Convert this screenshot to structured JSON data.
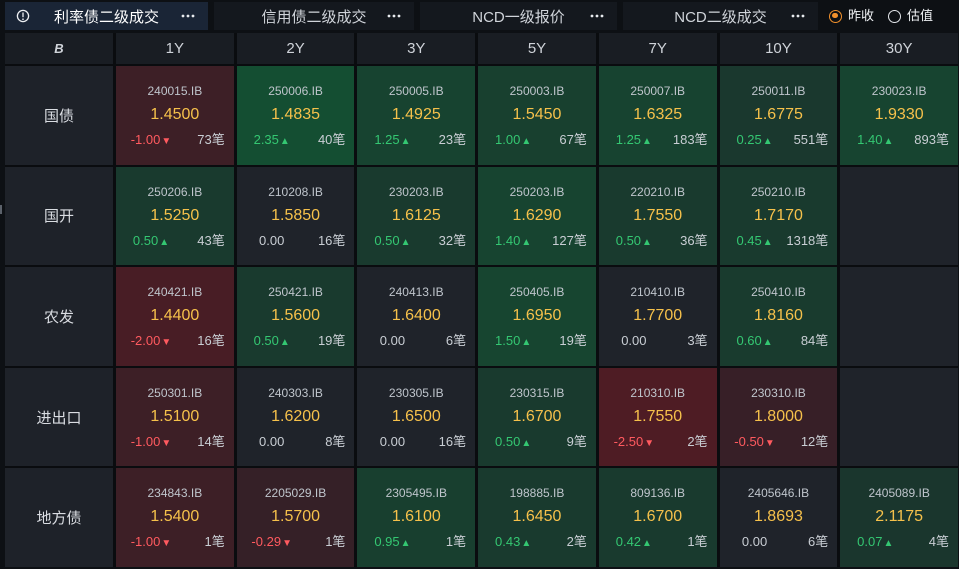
{
  "tabs": [
    {
      "label": "利率债二级成交",
      "active": true
    },
    {
      "label": "信用债二级成交",
      "active": false
    },
    {
      "label": "NCD一级报价",
      "active": false
    },
    {
      "label": "NCD二级成交",
      "active": false
    }
  ],
  "price_basis": {
    "options": [
      {
        "label": "昨收",
        "selected": true
      },
      {
        "label": "估值",
        "selected": false
      }
    ]
  },
  "icons": {
    "tab_info": "info-icon",
    "tab_menu": "more-horizontal-icon",
    "arrow_up": "▲",
    "arrow_down": "▼"
  },
  "colors": {
    "page_bg": "#0d1014",
    "tab_bg": "#14181e",
    "tab_active_bg": "#1a2536",
    "grid_gap": "#0a0c0f",
    "header_bg": "#191d23",
    "row_head_bg": "#1e2229",
    "cell_neutral": "#1f232a",
    "cell_up": "#145032",
    "cell_down": "#4e1c24",
    "price": "#f6c14b",
    "up": "#34c772",
    "down": "#ff5a5f",
    "radio_selected": "#f2912c"
  },
  "grid": {
    "corner_logo": "B",
    "tenors": [
      "1Y",
      "2Y",
      "3Y",
      "5Y",
      "7Y",
      "10Y",
      "30Y"
    ],
    "rows": [
      {
        "name": "国债",
        "cells": [
          {
            "code": "240015.IB",
            "price": "1.4500",
            "change": "-1.00",
            "direction": "down",
            "count": "73笔"
          },
          {
            "code": "250006.IB",
            "price": "1.4835",
            "change": "2.35",
            "direction": "up",
            "count": "40笔"
          },
          {
            "code": "250005.IB",
            "price": "1.4925",
            "change": "1.25",
            "direction": "up",
            "count": "23笔"
          },
          {
            "code": "250003.IB",
            "price": "1.5450",
            "change": "1.00",
            "direction": "up",
            "count": "67笔"
          },
          {
            "code": "250007.IB",
            "price": "1.6325",
            "change": "1.25",
            "direction": "up",
            "count": "183笔"
          },
          {
            "code": "250011.IB",
            "price": "1.6775",
            "change": "0.25",
            "direction": "up",
            "count": "551笔"
          },
          {
            "code": "230023.IB",
            "price": "1.9330",
            "change": "1.40",
            "direction": "up",
            "count": "893笔"
          }
        ]
      },
      {
        "name": "国开",
        "cells": [
          {
            "code": "250206.IB",
            "price": "1.5250",
            "change": "0.50",
            "direction": "up",
            "count": "43笔"
          },
          {
            "code": "210208.IB",
            "price": "1.5850",
            "change": "0.00",
            "direction": "flat",
            "count": "16笔"
          },
          {
            "code": "230203.IB",
            "price": "1.6125",
            "change": "0.50",
            "direction": "up",
            "count": "32笔"
          },
          {
            "code": "250203.IB",
            "price": "1.6290",
            "change": "1.40",
            "direction": "up",
            "count": "127笔"
          },
          {
            "code": "220210.IB",
            "price": "1.7550",
            "change": "0.50",
            "direction": "up",
            "count": "36笔"
          },
          {
            "code": "250210.IB",
            "price": "1.7170",
            "change": "0.45",
            "direction": "up",
            "count": "1318笔"
          },
          null
        ]
      },
      {
        "name": "农发",
        "cells": [
          {
            "code": "240421.IB",
            "price": "1.4400",
            "change": "-2.00",
            "direction": "down",
            "count": "16笔"
          },
          {
            "code": "250421.IB",
            "price": "1.5600",
            "change": "0.50",
            "direction": "up",
            "count": "19笔"
          },
          {
            "code": "240413.IB",
            "price": "1.6400",
            "change": "0.00",
            "direction": "flat",
            "count": "6笔"
          },
          {
            "code": "250405.IB",
            "price": "1.6950",
            "change": "1.50",
            "direction": "up",
            "count": "19笔"
          },
          {
            "code": "210410.IB",
            "price": "1.7700",
            "change": "0.00",
            "direction": "flat",
            "count": "3笔"
          },
          {
            "code": "250410.IB",
            "price": "1.8160",
            "change": "0.60",
            "direction": "up",
            "count": "84笔"
          },
          null
        ]
      },
      {
        "name": "进出口",
        "cells": [
          {
            "code": "250301.IB",
            "price": "1.5100",
            "change": "-1.00",
            "direction": "down",
            "count": "14笔"
          },
          {
            "code": "240303.IB",
            "price": "1.6200",
            "change": "0.00",
            "direction": "flat",
            "count": "8笔"
          },
          {
            "code": "230305.IB",
            "price": "1.6500",
            "change": "0.00",
            "direction": "flat",
            "count": "16笔"
          },
          {
            "code": "230315.IB",
            "price": "1.6700",
            "change": "0.50",
            "direction": "up",
            "count": "9笔"
          },
          {
            "code": "210310.IB",
            "price": "1.7550",
            "change": "-2.50",
            "direction": "down",
            "count": "2笔"
          },
          {
            "code": "230310.IB",
            "price": "1.8000",
            "change": "-0.50",
            "direction": "down",
            "count": "12笔"
          },
          null
        ]
      },
      {
        "name": "地方债",
        "cells": [
          {
            "code": "234843.IB",
            "price": "1.5400",
            "change": "-1.00",
            "direction": "down",
            "count": "1笔"
          },
          {
            "code": "2205029.IB",
            "price": "1.5700",
            "change": "-0.29",
            "direction": "down",
            "count": "1笔"
          },
          {
            "code": "2305495.IB",
            "price": "1.6100",
            "change": "0.95",
            "direction": "up",
            "count": "1笔"
          },
          {
            "code": "198885.IB",
            "price": "1.6450",
            "change": "0.43",
            "direction": "up",
            "count": "2笔"
          },
          {
            "code": "809136.IB",
            "price": "1.6700",
            "change": "0.42",
            "direction": "up",
            "count": "1笔"
          },
          {
            "code": "2405646.IB",
            "price": "1.8693",
            "change": "0.00",
            "direction": "flat",
            "count": "6笔"
          },
          {
            "code": "2405089.IB",
            "price": "2.1175",
            "change": "0.07",
            "direction": "up",
            "count": "4笔"
          }
        ]
      }
    ]
  }
}
